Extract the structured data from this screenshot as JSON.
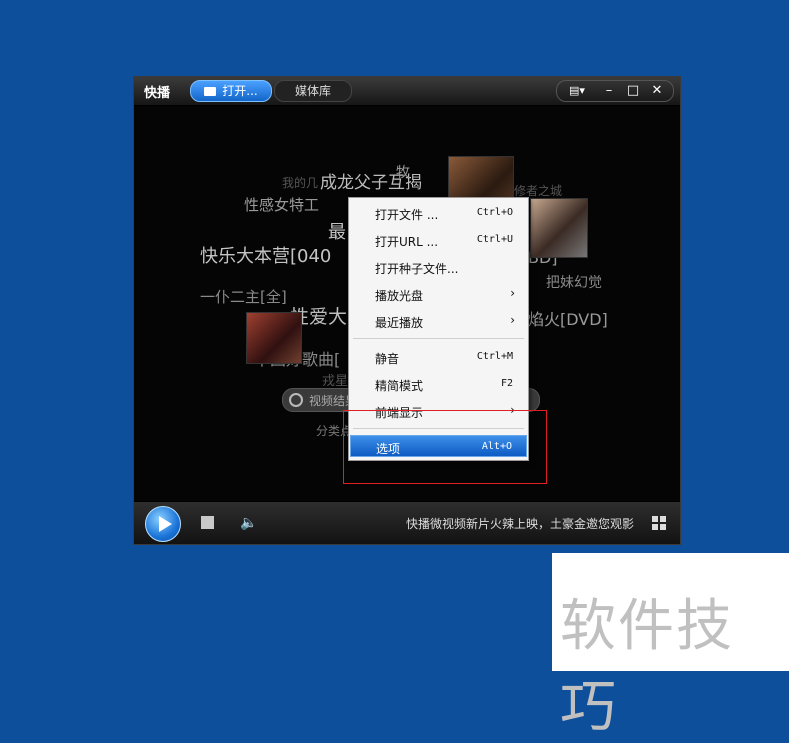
{
  "app": {
    "logo": "快播",
    "tab_open": "打开...",
    "tab_library": "媒体库",
    "win_menu_icon": "list-icon",
    "win_min": "–",
    "win_max": "□",
    "win_close": "✕"
  },
  "tag_cloud": [
    {
      "text": "成龙父子互揭",
      "size": 17,
      "color": "#bdbdbd"
    },
    {
      "text": "我的几",
      "size": 12,
      "color": "#555"
    },
    {
      "text": "性感女特工",
      "size": 15,
      "color": "#9a9a9a"
    },
    {
      "text": "快乐大本营[040",
      "size": 18,
      "color": "#c4c4c4"
    },
    {
      "text": "最",
      "size": 18,
      "color": "#c4c4c4"
    },
    {
      "text": "一仆二主[全]",
      "size": 15,
      "color": "#8a8a8a"
    },
    {
      "text": "性爱大",
      "size": 19,
      "color": "#bdbdbd"
    },
    {
      "text": "中国好歌曲[",
      "size": 16,
      "color": "#8a8a8a"
    },
    {
      "text": "戎星",
      "size": 13,
      "color": "#555"
    },
    {
      "text": "把妹幻觉",
      "size": 14,
      "color": "#8a8a8a"
    },
    {
      "text": "焰火[DVD]",
      "size": 16,
      "color": "#9a9a9a"
    },
    {
      "text": "BD]",
      "size": 16,
      "color": "#9a9a9a"
    },
    {
      "text": "修者之城",
      "size": 12,
      "color": "#555"
    },
    {
      "text": "分类点",
      "size": 12,
      "color": "#777"
    },
    {
      "text": "牧",
      "size": 14,
      "color": "#9a9a9a"
    }
  ],
  "search": {
    "placeholder": "视频结果"
  },
  "context_menu": {
    "items": [
      {
        "label": "打开文件 ...",
        "shortcut": "Ctrl+O"
      },
      {
        "label": "打开URL ...",
        "shortcut": "Ctrl+U"
      },
      {
        "label": "打开种子文件...",
        "shortcut": ""
      },
      {
        "label": "播放光盘",
        "shortcut": "",
        "submenu": true
      },
      {
        "label": "最近播放",
        "shortcut": "",
        "submenu": true
      },
      {
        "label": "静音",
        "shortcut": "Ctrl+M"
      },
      {
        "label": "精简模式",
        "shortcut": "F2"
      },
      {
        "label": "前端显示",
        "shortcut": "",
        "submenu": true
      },
      {
        "label": "选项",
        "shortcut": "Alt+O",
        "selected": true
      }
    ],
    "arrow": "›"
  },
  "bottom": {
    "promo_text": "快播微视频新片火辣上映，土豪金邀您观影",
    "volume_icon": "🔈"
  },
  "watermark": "软件技巧",
  "colors": {
    "desktop": "#0d4f9a",
    "accent": "#1a74d8",
    "highlight_box": "#e02020"
  }
}
